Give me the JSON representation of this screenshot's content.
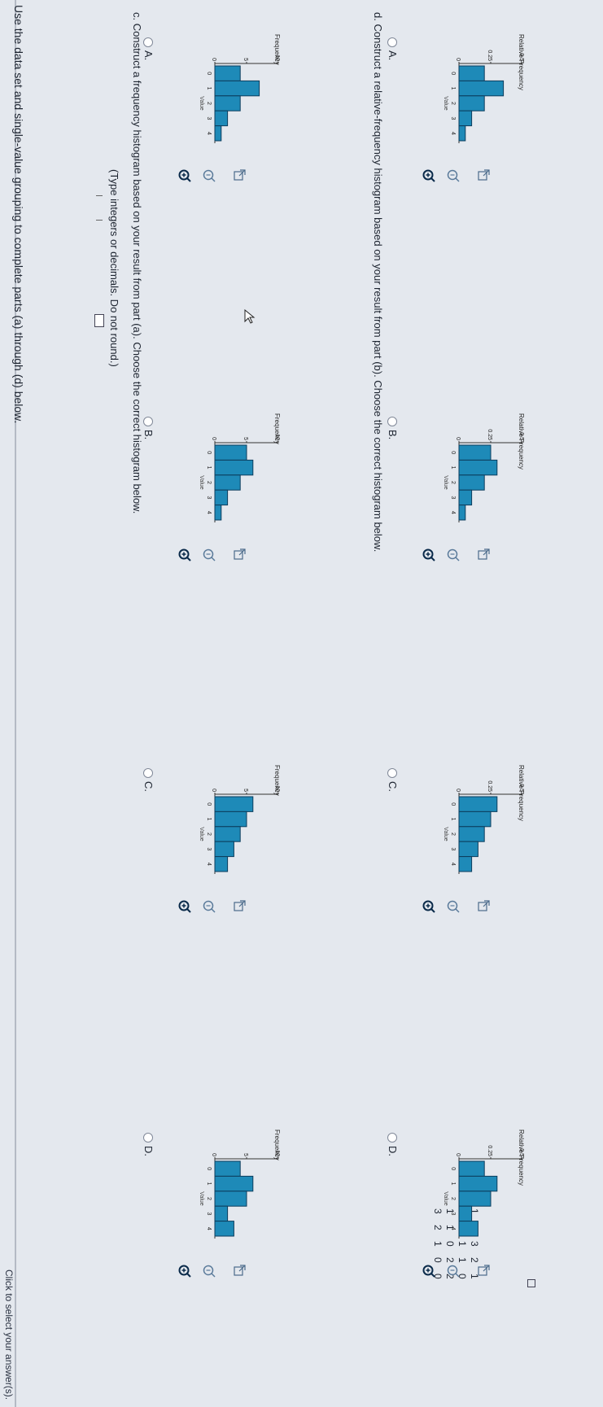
{
  "intro": "Use the data set and single-value grouping to complete parts (a) through (d) below.",
  "data_rows": [
    "1 2 3 2 1",
    "4 1 1 1 0",
    "1 1 0 2 2",
    "3 2 1 0 0"
  ],
  "answer_hint": "(Type integers or decimals. Do not round.)",
  "part_c": {
    "instruction": "c. Construct a frequency histogram based on your result from part (a). Choose the correct histogram below.",
    "ylabel": "Frequency",
    "xlabel": "Value",
    "yticks": [
      "0",
      "5",
      "10"
    ],
    "xticks": [
      "0",
      "1",
      "2",
      "3",
      "4"
    ],
    "options": [
      {
        "letter": "A.",
        "values": [
          4,
          7,
          4,
          2,
          1
        ]
      },
      {
        "letter": "B.",
        "values": [
          5,
          6,
          4,
          2,
          1
        ]
      },
      {
        "letter": "C.",
        "values": [
          6,
          5,
          4,
          3,
          2
        ]
      },
      {
        "letter": "D.",
        "values": [
          4,
          6,
          5,
          2,
          3
        ]
      }
    ]
  },
  "part_d": {
    "instruction": "d. Construct a relative-frequency histogram based on your result from part (b). Choose the correct histogram below.",
    "ylabel": "Relative Frequency",
    "xlabel": "Value",
    "yticks": [
      "0",
      "0.25",
      "0.5"
    ],
    "xticks": [
      "0",
      "1",
      "2",
      "3",
      "4"
    ],
    "options": [
      {
        "letter": "A.",
        "values": [
          0.2,
          0.35,
          0.2,
          0.1,
          0.05
        ]
      },
      {
        "letter": "B.",
        "values": [
          0.25,
          0.3,
          0.2,
          0.1,
          0.05
        ]
      },
      {
        "letter": "C.",
        "values": [
          0.3,
          0.25,
          0.2,
          0.15,
          0.1
        ]
      },
      {
        "letter": "D.",
        "values": [
          0.2,
          0.3,
          0.25,
          0.1,
          0.15
        ]
      }
    ]
  },
  "footer": "Click to select your answer(s).",
  "colors": {
    "bar": "#1e8ab8",
    "bar_stroke": "#0c3c5c",
    "zoom_icon": "#0a2a4a",
    "radio_border": "#808898"
  },
  "icons": [
    "zoom-in-icon",
    "zoom-out-icon",
    "expand-icon",
    "pointer-cursor-icon"
  ]
}
